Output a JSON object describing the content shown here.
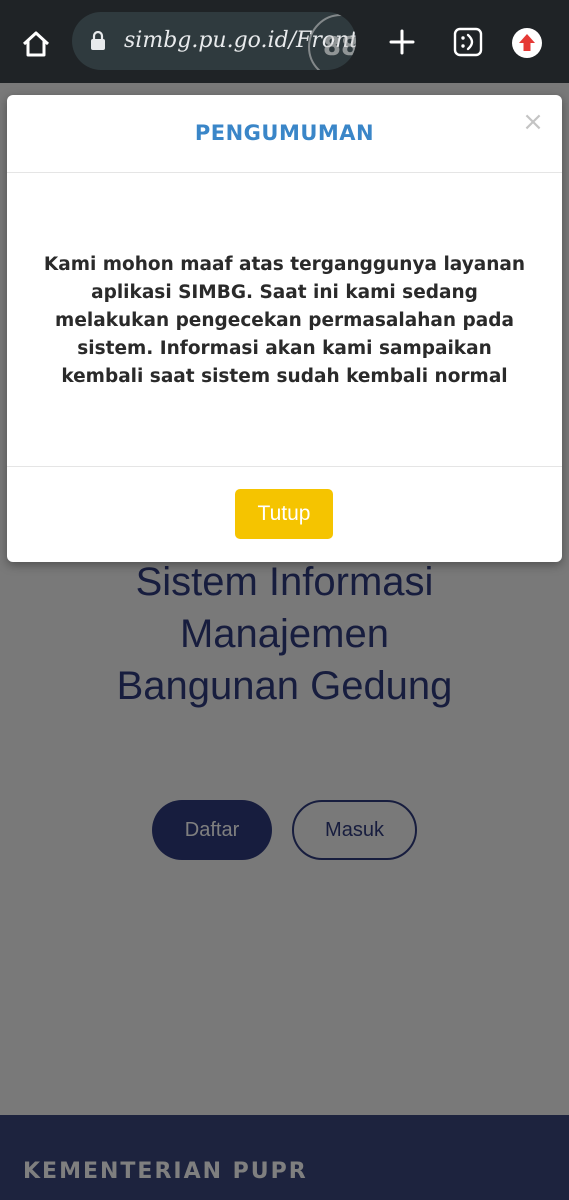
{
  "browser": {
    "url": "simbg.pu.go.id/Front",
    "tab_count": "88",
    "icons": [
      "home-icon",
      "lock-icon",
      "plus-icon",
      "reader-mode-icon",
      "update-icon"
    ]
  },
  "page": {
    "hero_title": "Sistem Informasi\nManajemen\nBangunan Gedung",
    "daftar_label": "Daftar",
    "masuk_label": "Masuk",
    "footer_title": "KEMENTERIAN PUPR"
  },
  "modal": {
    "title": "PENGUMUMAN",
    "close_symbol": "×",
    "message": "Kami mohon maaf atas terganggunya layanan aplikasi SIMBG. Saat ini kami sedang melakukan pengecekan permasalahan pada sistem. Informasi akan kami sampaikan kembali saat sistem sudah kembali normal",
    "button_label": "Tutup"
  },
  "colors": {
    "accent_blue": "#3a86c8",
    "brand_navy": "#2f3a7d",
    "button_yellow": "#f5c400",
    "toolbar_bg": "#1f2326"
  }
}
